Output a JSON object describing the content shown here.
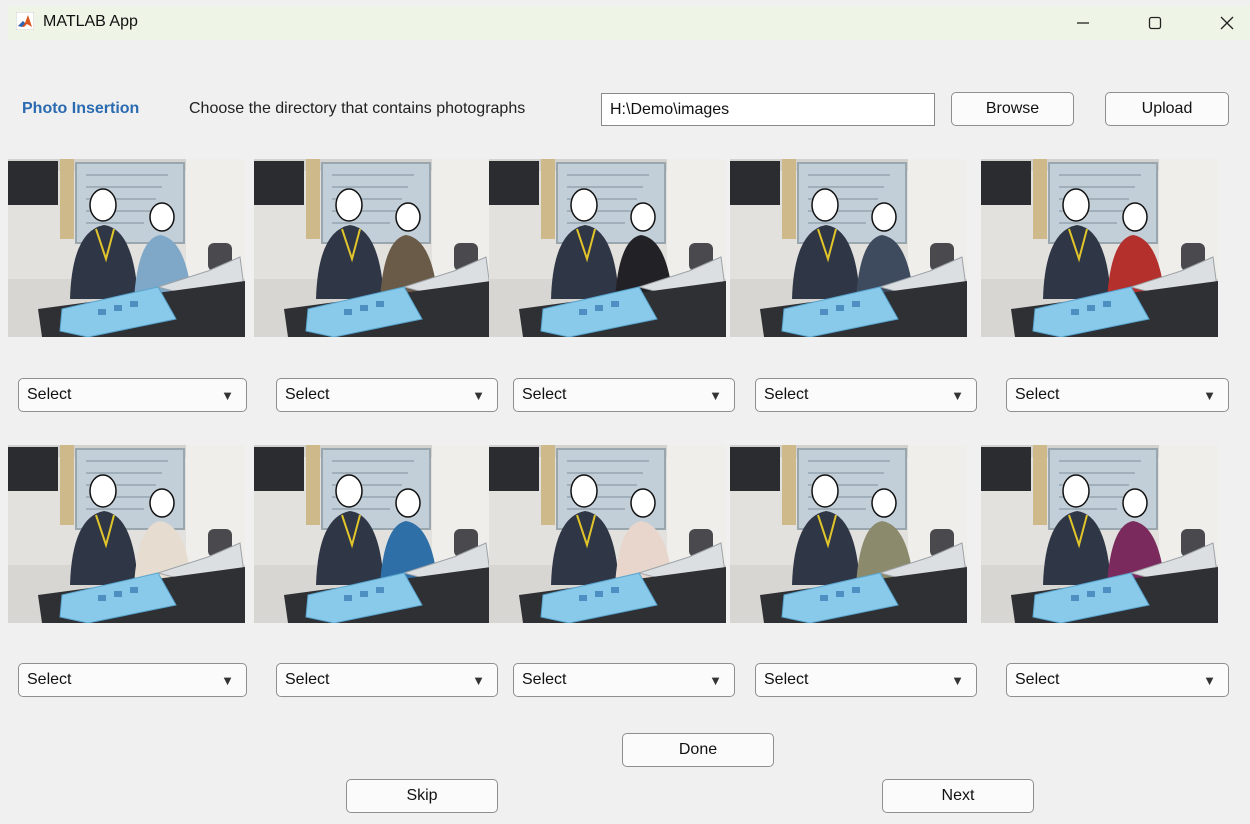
{
  "window": {
    "title": "MATLAB App"
  },
  "header": {
    "section_title": "Photo Insertion",
    "prompt": "Choose the directory that contains photographs",
    "directory_value": "H:\\Demo\\images",
    "browse_label": "Browse",
    "upload_label": "Upload"
  },
  "photos": [
    {
      "shirt": "#7fa8c8"
    },
    {
      "shirt": "#6a5a48"
    },
    {
      "shirt": "#222226"
    },
    {
      "shirt": "#3e4a5e"
    },
    {
      "shirt": "#b3302c"
    },
    {
      "shirt": "#e6dccf"
    },
    {
      "shirt": "#2f6fa8"
    },
    {
      "shirt": "#e8d6cc"
    },
    {
      "shirt": "#8c8a6c"
    },
    {
      "shirt": "#7a2a5c"
    }
  ],
  "dropdowns": [
    {
      "value": "Select"
    },
    {
      "value": "Select"
    },
    {
      "value": "Select"
    },
    {
      "value": "Select"
    },
    {
      "value": "Select"
    },
    {
      "value": "Select"
    },
    {
      "value": "Select"
    },
    {
      "value": "Select"
    },
    {
      "value": "Select"
    },
    {
      "value": "Select"
    }
  ],
  "footer": {
    "done_label": "Done",
    "skip_label": "Skip",
    "next_label": "Next"
  },
  "colors": {
    "accent": "#2a6ab0",
    "titlebar": "#eef5e6",
    "background": "#f0f0f0"
  },
  "icons": {
    "app": "matlab-logo-icon",
    "minimize": "minimize-icon",
    "maximize": "maximize-icon",
    "close": "close-icon",
    "dropdown": "triangle-down-icon"
  }
}
